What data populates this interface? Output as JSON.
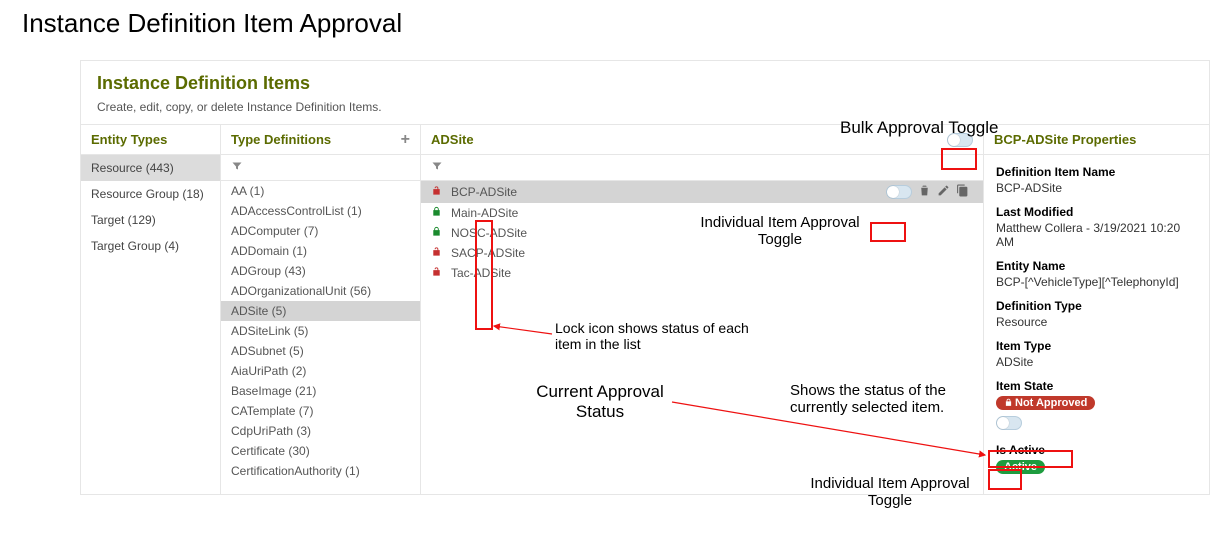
{
  "doc_title": "Instance Definition Item Approval",
  "page": {
    "title": "Instance Definition Items",
    "subtitle": "Create, edit, copy, or delete Instance Definition Items."
  },
  "cols": {
    "entity": "Entity Types",
    "typedef": "Type Definitions",
    "items": "ADSite",
    "props": "BCP-ADSite Properties"
  },
  "entity_types": [
    {
      "label": "Resource (443)",
      "selected": true
    },
    {
      "label": "Resource Group (18)"
    },
    {
      "label": "Target (129)"
    },
    {
      "label": "Target Group (4)"
    }
  ],
  "type_definitions": [
    {
      "label": "AA (1)"
    },
    {
      "label": "ADAccessControlList (1)"
    },
    {
      "label": "ADComputer (7)"
    },
    {
      "label": "ADDomain (1)"
    },
    {
      "label": "ADGroup (43)"
    },
    {
      "label": "ADOrganizationalUnit (56)"
    },
    {
      "label": "ADSite (5)",
      "selected": true
    },
    {
      "label": "ADSiteLink (5)"
    },
    {
      "label": "ADSubnet (5)"
    },
    {
      "label": "AiaUriPath (2)"
    },
    {
      "label": "BaseImage (21)"
    },
    {
      "label": "CATemplate (7)"
    },
    {
      "label": "CdpUriPath (3)"
    },
    {
      "label": "Certificate (30)"
    },
    {
      "label": "CertificationAuthority (1)"
    }
  ],
  "items": [
    {
      "label": "BCP-ADSite",
      "approved": false,
      "selected": true
    },
    {
      "label": "Main-ADSite",
      "approved": true
    },
    {
      "label": "NOSC-ADSite",
      "approved": true
    },
    {
      "label": "SACP-ADSite",
      "approved": false
    },
    {
      "label": "Tac-ADSite",
      "approved": false
    }
  ],
  "props": {
    "def_item_name_label": "Definition Item Name",
    "def_item_name": "BCP-ADSite",
    "last_mod_label": "Last Modified",
    "last_mod": "Matthew Collera - 3/19/2021 10:20 AM",
    "entity_name_label": "Entity Name",
    "entity_name": "BCP-[^VehicleType][^TelephonyId]",
    "def_type_label": "Definition Type",
    "def_type": "Resource",
    "item_type_label": "Item Type",
    "item_type": "ADSite",
    "item_state_label": "Item State",
    "item_state": "Not Approved",
    "is_active_label": "Is Active",
    "is_active": "Active"
  },
  "annotations": {
    "bulk": "Bulk Approval Toggle",
    "indiv": "Individual Item Approval Toggle",
    "lock": "Lock icon shows status of each item in the list",
    "current": "Current Approval Status",
    "selected": "Shows the status of the currently selected item.",
    "indiv2": "Individual Item Approval Toggle"
  }
}
